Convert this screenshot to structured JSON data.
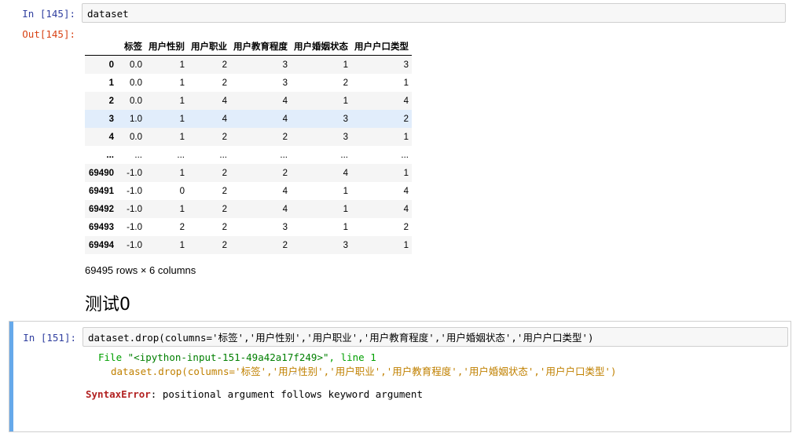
{
  "cell1": {
    "in_prompt": "In  [145]:",
    "code": "dataset",
    "out_prompt": "Out[145]:"
  },
  "dataframe": {
    "columns": [
      "",
      "标签",
      "用户性别",
      "用户职业",
      "用户教育程度",
      "用户婚姻状态",
      "用户户口类型"
    ],
    "rows": [
      {
        "index": "0",
        "values": [
          "0.0",
          "1",
          "2",
          "3",
          "1",
          "3"
        ]
      },
      {
        "index": "1",
        "values": [
          "0.0",
          "1",
          "2",
          "3",
          "2",
          "1"
        ]
      },
      {
        "index": "2",
        "values": [
          "0.0",
          "1",
          "4",
          "4",
          "1",
          "4"
        ]
      },
      {
        "index": "3",
        "values": [
          "1.0",
          "1",
          "4",
          "4",
          "3",
          "2"
        ]
      },
      {
        "index": "4",
        "values": [
          "0.0",
          "1",
          "2",
          "2",
          "3",
          "1"
        ]
      },
      {
        "index": "...",
        "values": [
          "...",
          "...",
          "...",
          "...",
          "...",
          "..."
        ]
      },
      {
        "index": "69490",
        "values": [
          "-1.0",
          "1",
          "2",
          "2",
          "4",
          "1"
        ]
      },
      {
        "index": "69491",
        "values": [
          "-1.0",
          "0",
          "2",
          "4",
          "1",
          "4"
        ]
      },
      {
        "index": "69492",
        "values": [
          "-1.0",
          "1",
          "2",
          "4",
          "1",
          "4"
        ]
      },
      {
        "index": "69493",
        "values": [
          "-1.0",
          "2",
          "2",
          "3",
          "1",
          "2"
        ]
      },
      {
        "index": "69494",
        "values": [
          "-1.0",
          "1",
          "2",
          "2",
          "3",
          "1"
        ]
      }
    ],
    "shape_text": "69495 rows × 6 columns"
  },
  "markdown": {
    "heading": "测试0"
  },
  "cell2": {
    "in_prompt": "In  [151]:",
    "code": "dataset.drop(columns='标签','用户性别','用户职业','用户教育程度','用户婚姻状态','用户户口类型')",
    "tb_file_kw": "File",
    "tb_file_name": "\"<ipython-input-151-49a42a17f249>\"",
    "tb_line": ", line 1",
    "tb_code": "dataset.drop(columns='标签','用户性别','用户职业','用户教育程度','用户婚姻状态','用户户口类型')",
    "tb_caret": "^",
    "error_type": "SyntaxError",
    "error_msg": ": positional argument follows keyword argument"
  }
}
